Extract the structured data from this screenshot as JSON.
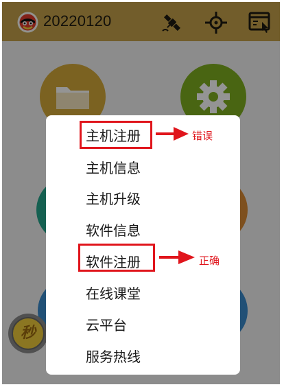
{
  "header": {
    "title": "20220120",
    "icons": [
      "logo-icon",
      "satellite-icon",
      "crosshair-icon",
      "exit-window-icon"
    ]
  },
  "home_tiles": [
    {
      "name": "folder-tile",
      "icon": "folder-icon",
      "color": "#d4a93a"
    },
    {
      "name": "settings-tile",
      "icon": "gear-icon",
      "color": "#7fae1f"
    },
    {
      "name": "teal-tile",
      "color": "#25a58c"
    },
    {
      "name": "orange-tile",
      "color": "#d98a35"
    },
    {
      "name": "blue-tile-left",
      "color": "#3a8bcc"
    },
    {
      "name": "blue-tile-right",
      "color": "#3a8bcc"
    }
  ],
  "side_button": {
    "label": "秒"
  },
  "menu": {
    "items": [
      "主机注册",
      "主机信息",
      "主机升级",
      "软件信息",
      "软件注册",
      "在线课堂",
      "云平台",
      "服务热线"
    ]
  },
  "annotations": {
    "wrong": "错误",
    "correct": "正确"
  },
  "colors": {
    "header": "#c4a04a",
    "annotation_red": "#e0151c",
    "overlay": "rgba(0,0,0,0.42)"
  }
}
